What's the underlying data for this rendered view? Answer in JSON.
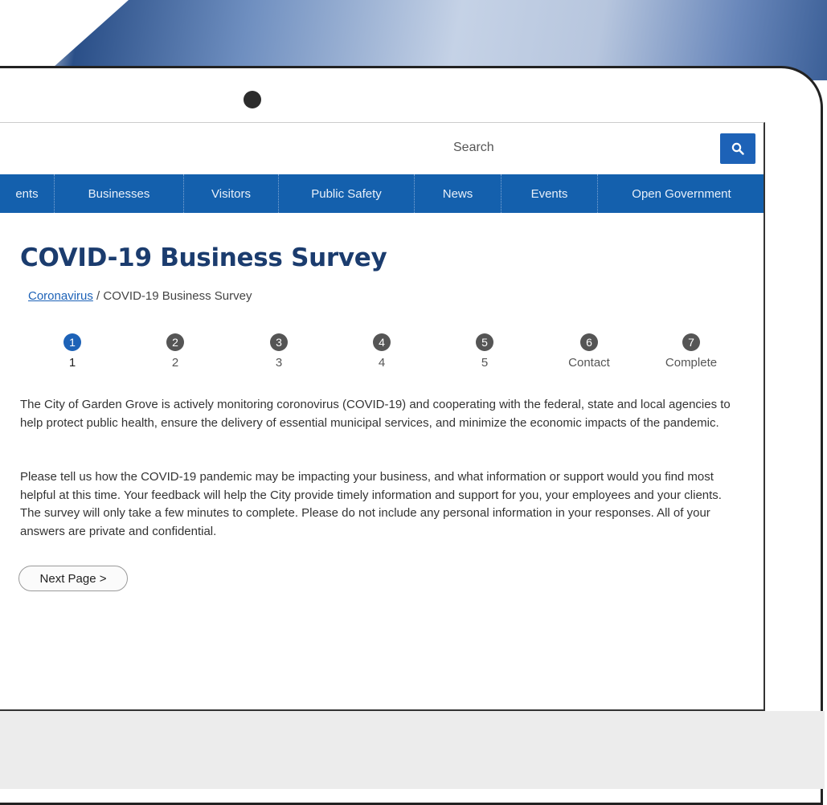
{
  "search": {
    "placeholder": "Search"
  },
  "nav": {
    "items": [
      {
        "label": "ents"
      },
      {
        "label": "Businesses"
      },
      {
        "label": "Visitors"
      },
      {
        "label": "Public Safety"
      },
      {
        "label": "News"
      },
      {
        "label": "Events"
      },
      {
        "label": "Open Government"
      }
    ]
  },
  "page": {
    "title": "COVID-19 Business Survey",
    "breadcrumb": {
      "link": "Coronavirus",
      "separator": "/",
      "current": "COVID-19 Business Survey"
    }
  },
  "steps": [
    {
      "number": "1",
      "label": "1",
      "active": true
    },
    {
      "number": "2",
      "label": "2"
    },
    {
      "number": "3",
      "label": "3"
    },
    {
      "number": "4",
      "label": "4"
    },
    {
      "number": "5",
      "label": "5"
    },
    {
      "number": "6",
      "label": "Contact"
    },
    {
      "number": "7",
      "label": "Complete"
    }
  ],
  "content": {
    "paragraph1": "The City of Garden Grove is actively monitoring coronovirus (COVID-19) and cooperating with the federal, state and local agencies to help protect public health, ensure the delivery of essential municipal services, and minimize the economic impacts of the pandemic.",
    "paragraph2": "Please tell us how the COVID-19 pandemic may be impacting your business, and what information or support would you find most helpful at this time. Your feedback will help the City provide timely information and support for you, your employees and your clients. The survey will only take a few minutes to complete. Please do not include any personal information in your responses. All of your answers are private and confidential.",
    "next_button": "Next Page >"
  },
  "colors": {
    "accent": "#1d62b7",
    "nav_bg": "#1460ad",
    "title": "#1b3c6e",
    "step_inactive": "#555555"
  },
  "icons": {
    "search": "search-icon"
  }
}
